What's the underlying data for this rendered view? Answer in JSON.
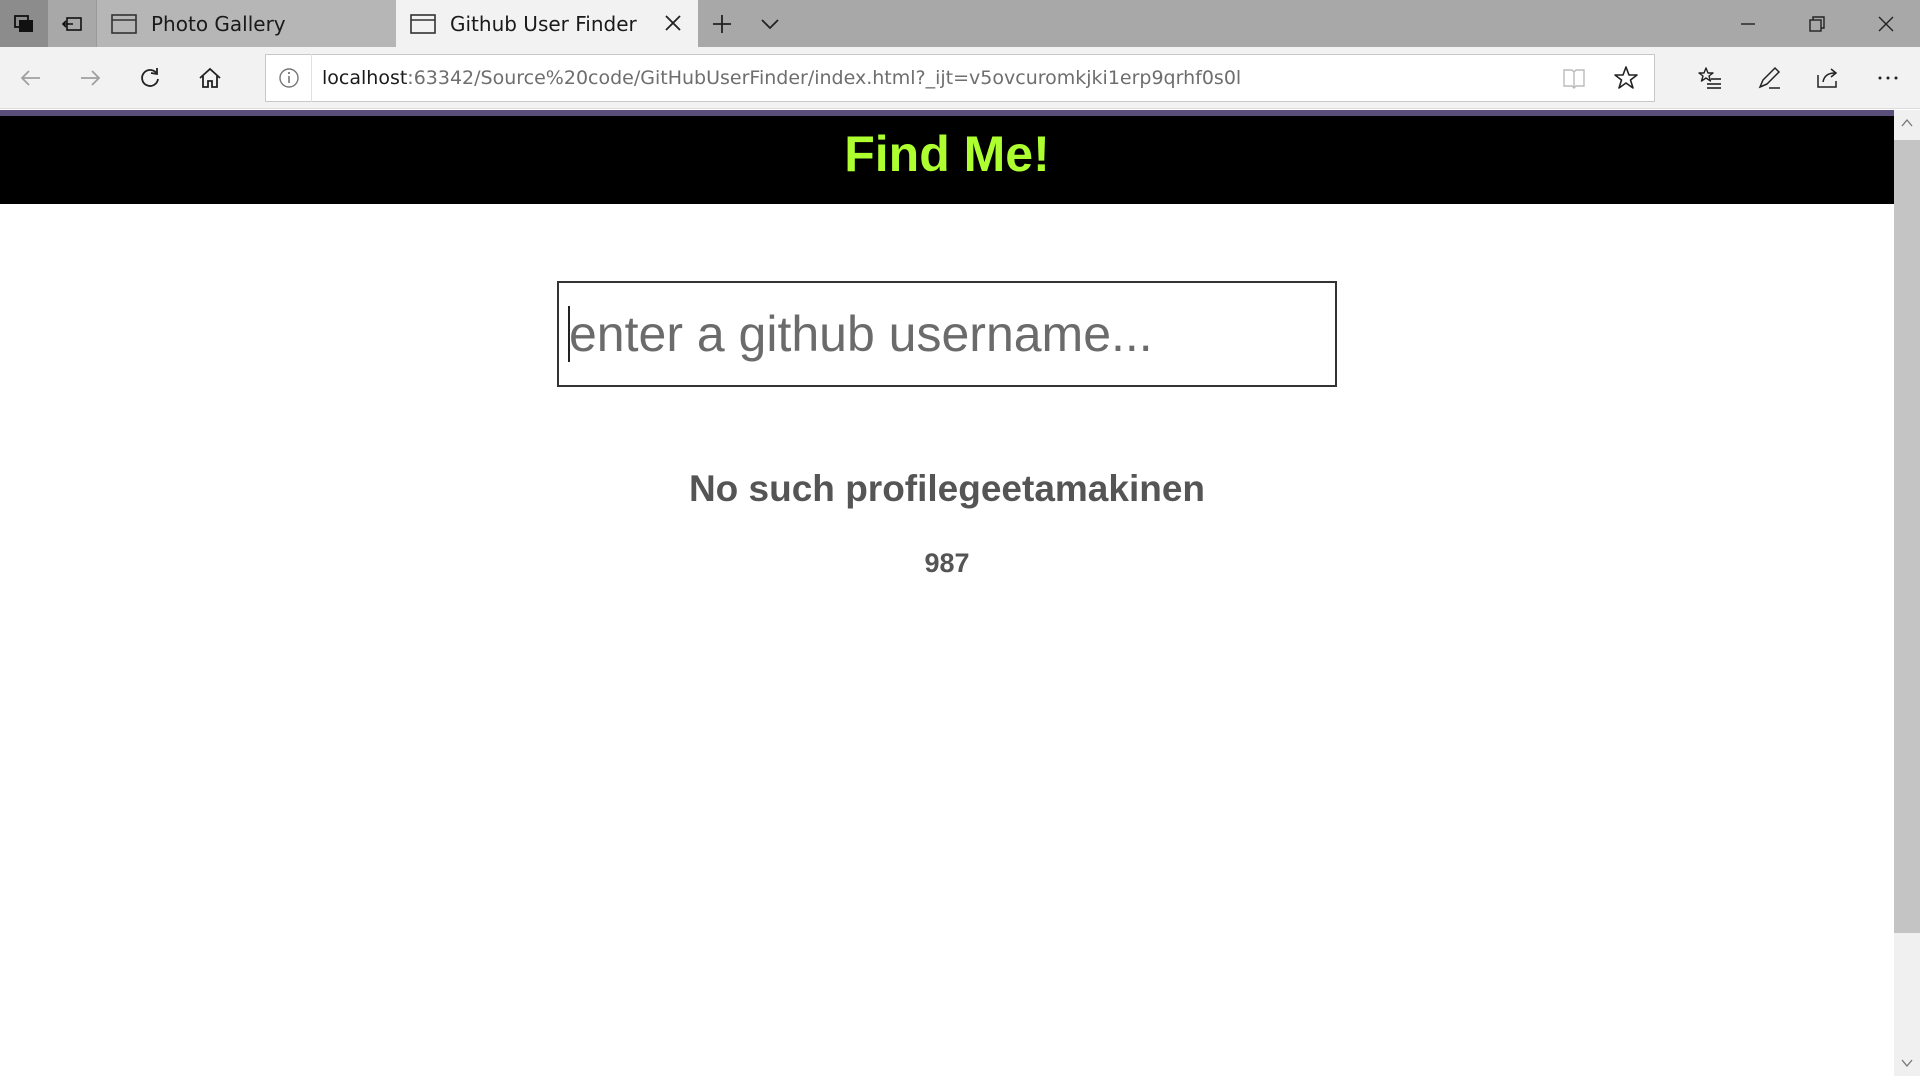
{
  "browser": {
    "tabs": [
      {
        "title": "Photo Gallery",
        "active": false
      },
      {
        "title": "Github User Finder",
        "active": true
      }
    ],
    "address": {
      "host": "localhost",
      "path": ":63342/Source%20code/GitHubUserFinder/index.html?_ijt=v5ovcuromkjki1erp9qrhf0s0l"
    },
    "icons": {
      "tab_manager": "tab-manager-icon",
      "set_aside": "set-aside-tabs-icon",
      "back": "back-arrow-icon",
      "forward": "forward-arrow-icon",
      "refresh": "refresh-icon",
      "home": "home-icon",
      "info": "site-info-icon",
      "reading_view": "reading-view-icon",
      "favorite": "star-icon",
      "favorites_hub": "favorites-hub-icon",
      "web_note": "pen-icon",
      "share": "share-icon",
      "more": "more-icon"
    }
  },
  "page": {
    "header_title": "Find Me!",
    "search": {
      "placeholder": "enter a github username...",
      "value": ""
    },
    "result_title": "No such profilegeetamakinen",
    "result_count": "987"
  },
  "colors": {
    "header_bg": "#000000",
    "header_text": "#adff2f",
    "result_text": "#555555"
  }
}
